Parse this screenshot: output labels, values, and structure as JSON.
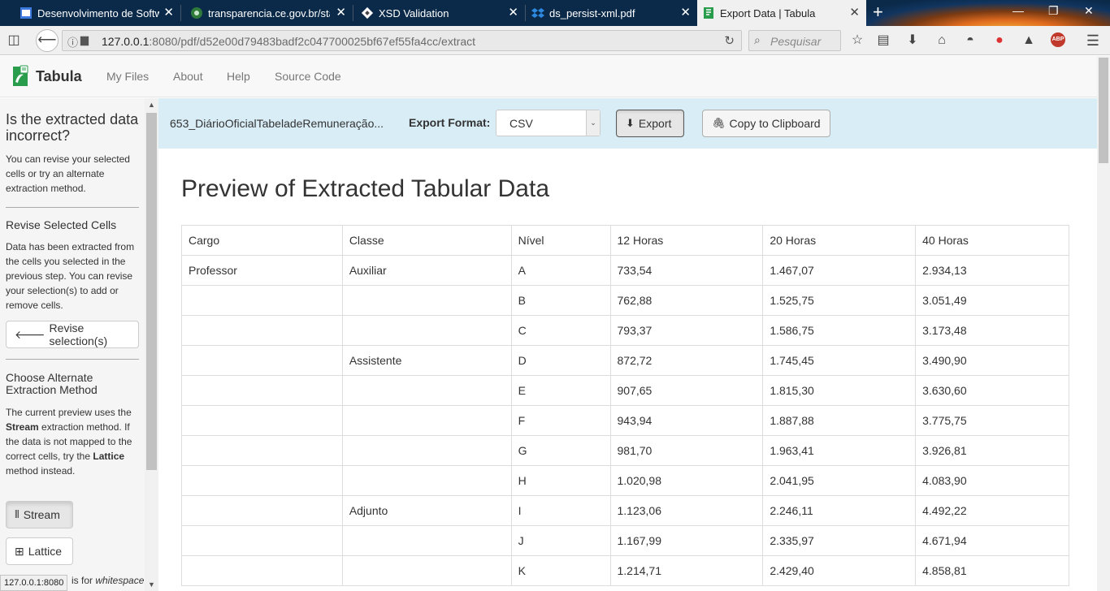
{
  "browser": {
    "tabs": [
      {
        "title": "Desenvolvimento de Software",
        "active": false
      },
      {
        "title": "transparencia.ce.gov.br/static",
        "active": false
      },
      {
        "title": "XSD Validation",
        "active": false
      },
      {
        "title": "ds_persist-xml.pdf",
        "active": false
      },
      {
        "title": "Export Data | Tabula",
        "active": true
      }
    ],
    "url_host": "127.0.0.1",
    "url_rest": ":8080/pdf/d52e00d79483badf2c047700025bf67ef55fa4cc/extract",
    "search_placeholder": "Pesquisar",
    "abp_label": "ABP",
    "status_url": "127.0.0.1:8080"
  },
  "app": {
    "brand": "Tabula",
    "nav": [
      "My Files",
      "About",
      "Help",
      "Source Code"
    ]
  },
  "sidebar": {
    "heading": "Is the extracted data incorrect?",
    "intro": "You can revise your selected cells or try an alternate extraction method.",
    "revise_title": "Revise Selected Cells",
    "revise_text": "Data has been extracted from the cells you selected in the previous step. You can revise your selection(s) to add or remove cells.",
    "revise_button": "Revise selection(s)",
    "method_title": "Choose Alternate Extraction Method",
    "method_text_1": "The current preview uses the ",
    "method_bold_1": "Stream",
    "method_text_2": " extraction method. If the data is not mapped to the correct cells, try the ",
    "method_bold_2": "Lattice",
    "method_text_3": " method instead.",
    "stream_button": "Stream",
    "lattice_button": "Lattice",
    "footer_text_1": "is for ",
    "footer_italic": "whitespace"
  },
  "toolbar": {
    "filename": "653_DiárioOficialTabeladeRemuneração...",
    "format_label": "Export Format:",
    "format_value": "CSV",
    "export_button": "Export",
    "copy_button": "Copy to Clipboard"
  },
  "preview": {
    "title": "Preview of Extracted Tabular Data",
    "columns": [
      "Cargo",
      "Classe",
      "Nível",
      "12 Horas",
      "20 Horas",
      "40 Horas"
    ],
    "rows": [
      [
        "Professor",
        "Auxiliar",
        "A",
        "733,54",
        "1.467,07",
        "2.934,13"
      ],
      [
        "",
        "",
        "B",
        "762,88",
        "1.525,75",
        "3.051,49"
      ],
      [
        "",
        "",
        "C",
        "793,37",
        "1.586,75",
        "3.173,48"
      ],
      [
        "",
        "Assistente",
        "D",
        "872,72",
        "1.745,45",
        "3.490,90"
      ],
      [
        "",
        "",
        "E",
        "907,65",
        "1.815,30",
        "3.630,60"
      ],
      [
        "",
        "",
        "F",
        "943,94",
        "1.887,88",
        "3.775,75"
      ],
      [
        "",
        "",
        "G",
        "981,70",
        "1.963,41",
        "3.926,81"
      ],
      [
        "",
        "",
        "H",
        "1.020,98",
        "2.041,95",
        "4.083,90"
      ],
      [
        "",
        "Adjunto",
        "I",
        "1.123,06",
        "2.246,11",
        "4.492,22"
      ],
      [
        "",
        "",
        "J",
        "1.167,99",
        "2.335,97",
        "4.671,94"
      ],
      [
        "",
        "",
        "K",
        "1.214,71",
        "2.429,40",
        "4.858,81"
      ]
    ]
  }
}
